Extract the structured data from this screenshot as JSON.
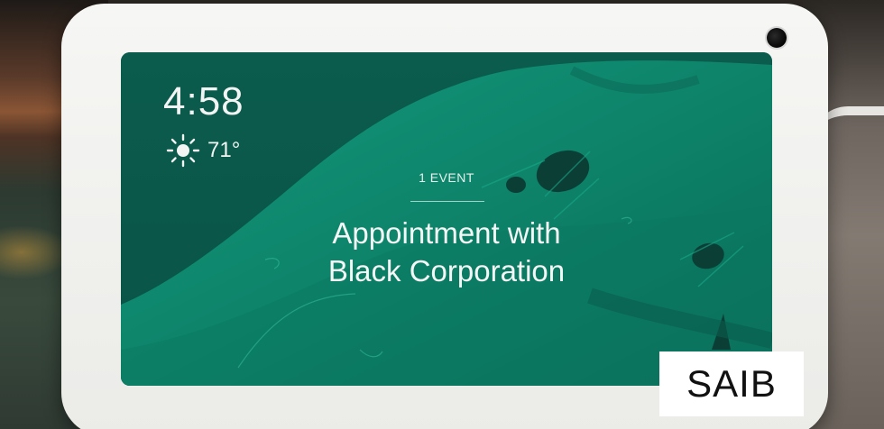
{
  "screen": {
    "time": "4:58",
    "weather": {
      "icon": "sun-icon",
      "temperature": "71°"
    },
    "event": {
      "count_label": "1 EVENT",
      "title_line1": "Appointment with",
      "title_line2": "Black Corporation"
    }
  },
  "watermark": {
    "text": "SAIB"
  },
  "colors": {
    "screen_teal": "#0b5a4c",
    "screen_wave": "#0e8a70",
    "device_bezel": "#f2f2f0"
  }
}
